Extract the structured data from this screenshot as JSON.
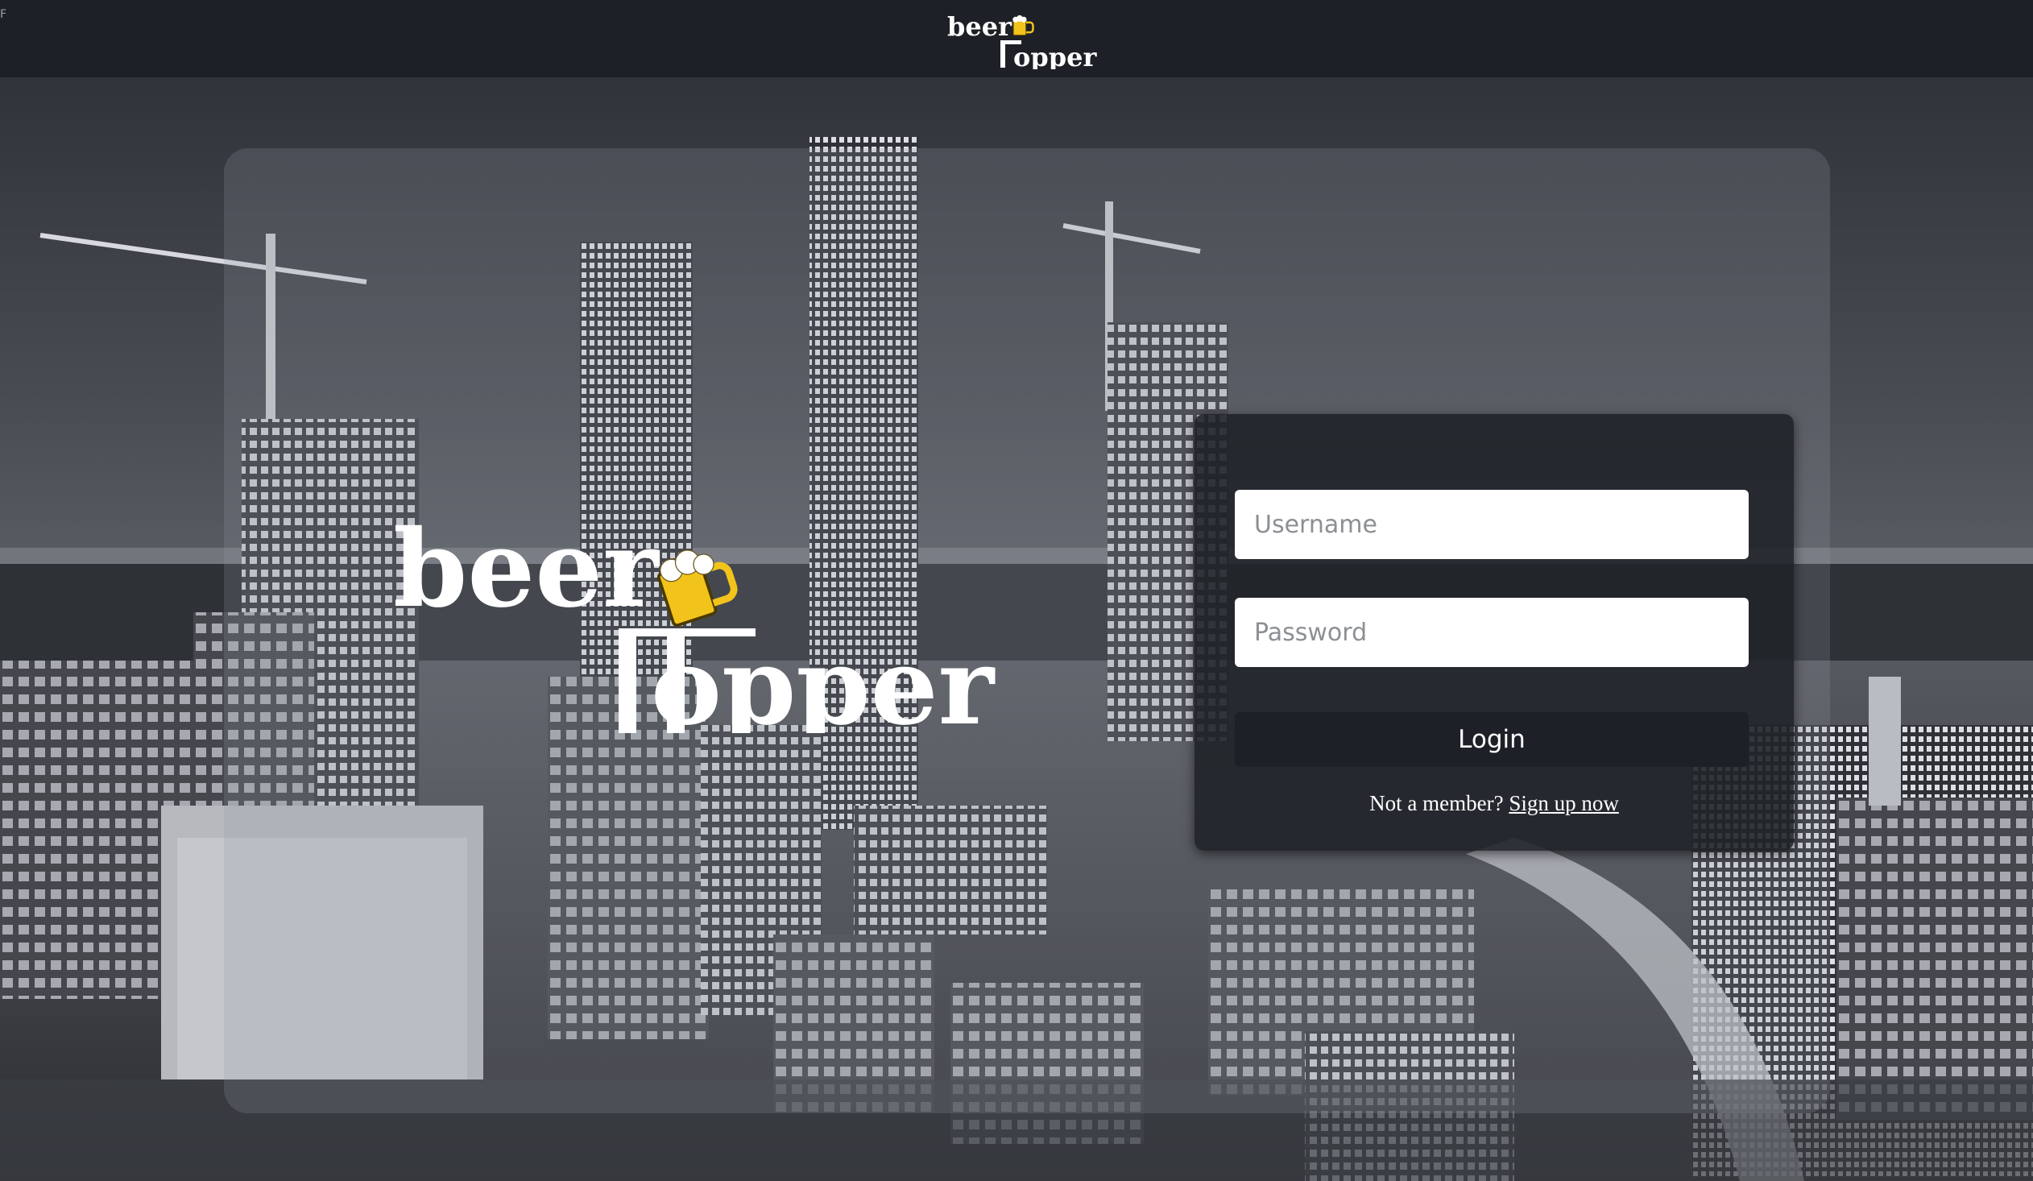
{
  "app": {
    "corner_mark": "F",
    "brand_name": "beer Hopper"
  },
  "login": {
    "username_placeholder": "Username",
    "password_placeholder": "Password",
    "login_label": "Login",
    "not_member_text": "Not a member?",
    "signup_link_text": "Sign up now"
  },
  "colors": {
    "navbar": "#1d2026",
    "card": "#1e2127",
    "button": "#1d2026",
    "mug_yellow": "#f2c31a"
  },
  "icons": {
    "brand_mug": "beer-mug-icon"
  }
}
